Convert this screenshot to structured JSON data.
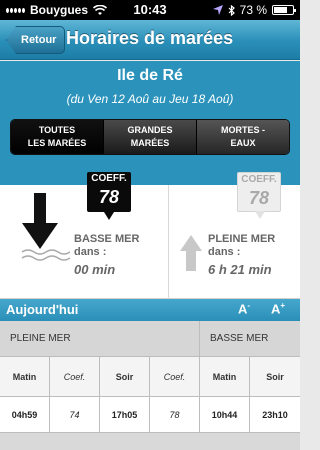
{
  "status_bar": {
    "carrier": "Bouygues",
    "time": "10:43",
    "battery_percent": "73 %",
    "battery_level": 0.73
  },
  "nav": {
    "back_label": "Retour",
    "title": "Horaires de marées"
  },
  "location": {
    "name": "Ile de Ré",
    "date_range": "(du Ven 12 Aoû au Jeu 18 Aoû)"
  },
  "segments": [
    {
      "line1": "TOUTES",
      "line2": "LES MARÉES",
      "selected": true
    },
    {
      "line1": "GRANDES",
      "line2": "MARÉES",
      "selected": false
    },
    {
      "line1": "MORTES -",
      "line2": "EAUX",
      "selected": false
    }
  ],
  "tides": {
    "low": {
      "coef_label": "COEFF.",
      "coef": "78",
      "title": "BASSE MER",
      "dans": "dans :",
      "time": "00 min"
    },
    "high": {
      "coef_label": "COEFF.",
      "coef": "78",
      "title": "PLEINE MER",
      "dans": "dans :",
      "time": "6 h 21 min"
    }
  },
  "today": {
    "label": "Aujourd'hui",
    "font_smaller": "A",
    "font_smaller_sign": "-",
    "font_larger": "A",
    "font_larger_sign": "+"
  },
  "table": {
    "sections": [
      "PLEINE MER",
      "BASSE MER"
    ],
    "columns": [
      "Matin",
      "Coef.",
      "Soir",
      "Coef.",
      "Matin",
      "Soir"
    ],
    "values": [
      "04h59",
      "74",
      "17h05",
      "78",
      "10h44",
      "23h10"
    ]
  },
  "colors": {
    "nav_blue": "#2a8fb8",
    "segment_dark": "#000000"
  },
  "icons": {
    "signal": "signal-bars-icon",
    "wifi": "wifi-icon",
    "location": "location-arrow-icon",
    "bluetooth": "bluetooth-icon",
    "battery": "battery-icon",
    "down_arrow": "arrow-down-icon",
    "up_arrow": "arrow-up-icon",
    "wave": "wave-icon"
  }
}
